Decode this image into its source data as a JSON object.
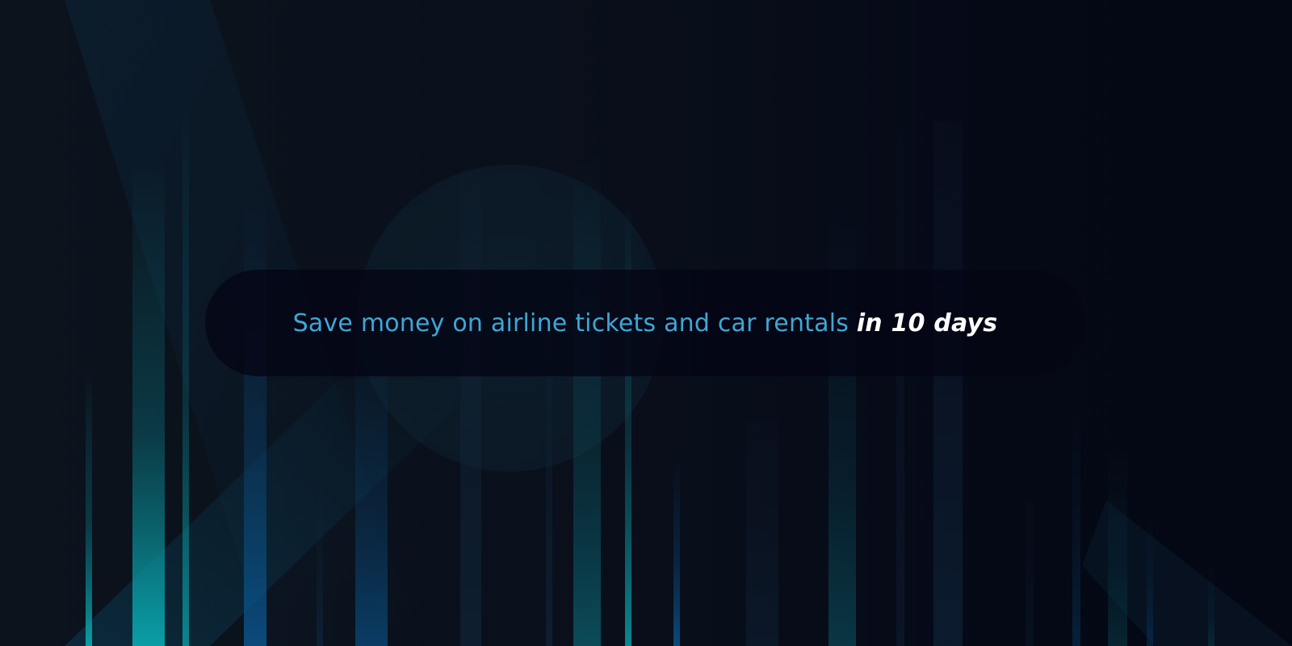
{
  "banner": {
    "text_main": "Save money on airline tickets and car rentals",
    "text_emphasis": "in 10 days"
  },
  "colors": {
    "background": "#0a0f19",
    "banner_fill": "#040514",
    "text_main": "#3fa6d6",
    "text_emphasis": "#ffffff",
    "accent_teal": "#0aa2a8",
    "accent_blue": "#0a5a9c"
  }
}
